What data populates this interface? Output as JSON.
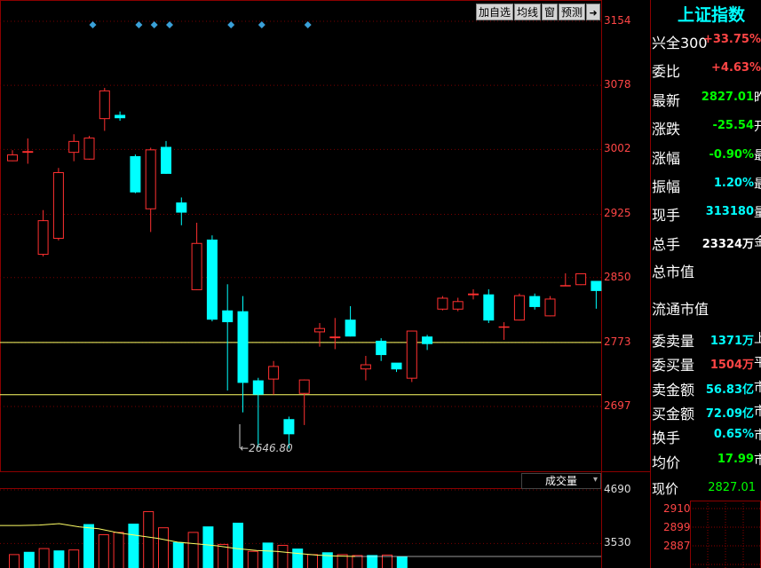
{
  "toolbar": {
    "add_watchlist": "加自选",
    "ma_line": "均线",
    "window": "窗",
    "forecast": "预测",
    "arrow_icon": "exit-arrow-icon"
  },
  "price_axis": [
    "3154",
    "3078",
    "3002",
    "2925",
    "2850",
    "2773",
    "2697"
  ],
  "volume_axis": [
    "4690",
    "3530"
  ],
  "volume_selector": "成交量",
  "low_annotation": "2646.80",
  "colors": {
    "up": "#ff3030",
    "down": "#00ffff",
    "grid": "#7a0000",
    "ma_yellow": "#ffff66",
    "panel_cyan": "#00ffff"
  },
  "panel": {
    "title": "上证指数",
    "rows": [
      {
        "label": "兴全300",
        "value": "+33.75%",
        "color": "red",
        "suffix": ""
      },
      {
        "label": "委比",
        "value": "+4.63%",
        "color": "red",
        "suffix": ""
      },
      {
        "label": "最新",
        "value": "2827.01",
        "color": "green",
        "suffix": "昨"
      },
      {
        "label": "涨跌",
        "value": "-25.54",
        "color": "green",
        "suffix": "开"
      },
      {
        "label": "涨幅",
        "value": "-0.90%",
        "color": "green",
        "suffix": "最"
      },
      {
        "label": "振幅",
        "value": "1.20%",
        "color": "cyan",
        "suffix": "最"
      },
      {
        "label": "现手",
        "value": "313180",
        "color": "cyan",
        "suffix": "量"
      },
      {
        "label": "总手",
        "value": "23324万",
        "color": "white",
        "suffix": "金"
      }
    ],
    "total_mkt_cap": "总市值",
    "float_mkt_cap": "流通市值",
    "rows2": [
      {
        "label": "委卖量",
        "value": "1371万",
        "color": "cyan",
        "suffix": "上"
      },
      {
        "label": "委买量",
        "value": "1504万",
        "color": "red",
        "suffix": "平"
      },
      {
        "label": "卖金额",
        "value": "56.83亿",
        "color": "cyan",
        "suffix": "市"
      },
      {
        "label": "买金额",
        "value": "72.09亿",
        "color": "cyan",
        "suffix": "市"
      },
      {
        "label": "换手",
        "value": "0.65%",
        "color": "cyan",
        "suffix": "市"
      },
      {
        "label": "均价",
        "value": "17.99",
        "color": "green",
        "suffix": "市"
      }
    ],
    "now_price_label": "现价",
    "now_price_value": "2827.01",
    "mini_axis": [
      "2910",
      "2899",
      "2887"
    ]
  },
  "chart_data": {
    "type": "candlestick",
    "ylim": [
      2646.8,
      3154
    ],
    "candles": [
      {
        "o": 2988,
        "c": 2996,
        "h": 3001,
        "l": 2988
      },
      {
        "o": 2998,
        "c": 3000,
        "h": 3015,
        "l": 2985
      },
      {
        "o": 2877,
        "c": 2918,
        "h": 2930,
        "l": 2875
      },
      {
        "o": 2896,
        "c": 2975,
        "h": 2980,
        "l": 2894
      },
      {
        "o": 2998,
        "c": 3012,
        "h": 3020,
        "l": 2988
      },
      {
        "o": 2990,
        "c": 3016,
        "h": 3018,
        "l": 2990
      },
      {
        "o": 3038,
        "c": 3072,
        "h": 3075,
        "l": 3024
      },
      {
        "o": 3043,
        "c": 3039,
        "h": 3047,
        "l": 3036
      },
      {
        "o": 2994,
        "c": 2951,
        "h": 2996,
        "l": 2950
      },
      {
        "o": 2931,
        "c": 3002,
        "h": 3004,
        "l": 2904
      },
      {
        "o": 3005,
        "c": 2973,
        "h": 3012,
        "l": 2973
      },
      {
        "o": 2939,
        "c": 2927,
        "h": 2945,
        "l": 2912
      },
      {
        "o": 2835,
        "c": 2891,
        "h": 2915,
        "l": 2835
      },
      {
        "o": 2895,
        "c": 2800,
        "h": 2900,
        "l": 2798
      },
      {
        "o": 2811,
        "c": 2797,
        "h": 2842,
        "l": 2716
      },
      {
        "o": 2810,
        "c": 2725,
        "h": 2828,
        "l": 2690
      },
      {
        "o": 2728,
        "c": 2711,
        "h": 2731,
        "l": 2649
      },
      {
        "o": 2729,
        "c": 2745,
        "h": 2751,
        "l": 2711
      },
      {
        "o": 2682,
        "c": 2664,
        "h": 2685,
        "l": 2647
      },
      {
        "o": 2712,
        "c": 2729,
        "h": 2729,
        "l": 2675
      },
      {
        "o": 2785,
        "c": 2790,
        "h": 2796,
        "l": 2768
      },
      {
        "o": 2778,
        "c": 2780,
        "h": 2802,
        "l": 2765
      },
      {
        "o": 2800,
        "c": 2780,
        "h": 2816,
        "l": 2780
      },
      {
        "o": 2741,
        "c": 2747,
        "h": 2757,
        "l": 2728
      },
      {
        "o": 2775,
        "c": 2758,
        "h": 2778,
        "l": 2751
      },
      {
        "o": 2749,
        "c": 2741,
        "h": 2748,
        "l": 2738
      },
      {
        "o": 2730,
        "c": 2787,
        "h": 2787,
        "l": 2726
      },
      {
        "o": 2780,
        "c": 2771,
        "h": 2782,
        "l": 2764
      },
      {
        "o": 2812,
        "c": 2826,
        "h": 2828,
        "l": 2811
      },
      {
        "o": 2812,
        "c": 2822,
        "h": 2826,
        "l": 2810
      },
      {
        "o": 2829,
        "c": 2831,
        "h": 2836,
        "l": 2824
      },
      {
        "o": 2830,
        "c": 2799,
        "h": 2836,
        "l": 2796
      },
      {
        "o": 2792,
        "c": 2792,
        "h": 2797,
        "l": 2776
      },
      {
        "o": 2799,
        "c": 2829,
        "h": 2831,
        "l": 2799
      },
      {
        "o": 2828,
        "c": 2815,
        "h": 2831,
        "l": 2812
      },
      {
        "o": 2804,
        "c": 2825,
        "h": 2828,
        "l": 2804
      },
      {
        "o": 2841,
        "c": 2841,
        "h": 2855,
        "l": 2840
      },
      {
        "o": 2841,
        "c": 2855,
        "h": 2855,
        "l": 2841
      },
      {
        "o": 2846,
        "c": 2834,
        "h": 2846,
        "l": 2813
      }
    ],
    "ma_lines_price": [
      2773,
      2711
    ],
    "volumes": [
      {
        "v": 3300,
        "up": true
      },
      {
        "v": 3350,
        "up": false
      },
      {
        "v": 3430,
        "up": true
      },
      {
        "v": 3380,
        "up": false
      },
      {
        "v": 3400,
        "up": true
      },
      {
        "v": 3950,
        "up": false
      },
      {
        "v": 3730,
        "up": true
      },
      {
        "v": 3780,
        "up": true
      },
      {
        "v": 3960,
        "up": false
      },
      {
        "v": 4230,
        "up": true
      },
      {
        "v": 3880,
        "up": true
      },
      {
        "v": 3560,
        "up": false
      },
      {
        "v": 3780,
        "up": true
      },
      {
        "v": 3900,
        "up": false
      },
      {
        "v": 3520,
        "up": true
      },
      {
        "v": 3980,
        "up": false
      },
      {
        "v": 3370,
        "up": true
      },
      {
        "v": 3550,
        "up": false
      },
      {
        "v": 3500,
        "up": true
      },
      {
        "v": 3420,
        "up": false
      },
      {
        "v": 3300,
        "up": true
      },
      {
        "v": 3340,
        "up": false
      },
      {
        "v": 3300,
        "up": true
      },
      {
        "v": 3280,
        "up": true
      },
      {
        "v": 3280,
        "up": false
      },
      {
        "v": 3290,
        "up": true
      },
      {
        "v": 3250,
        "up": false
      }
    ],
    "volume_ylim": [
      3000,
      4690
    ],
    "ma_volume": [
      3920,
      3920,
      3930,
      3960,
      3890,
      3850,
      3760,
      3700,
      3640,
      3560,
      3520,
      3480,
      3420,
      3380,
      3360,
      3320,
      3280,
      3260,
      3250
    ],
    "signal_markers": [
      5,
      8,
      9,
      10,
      14,
      16,
      19
    ]
  }
}
